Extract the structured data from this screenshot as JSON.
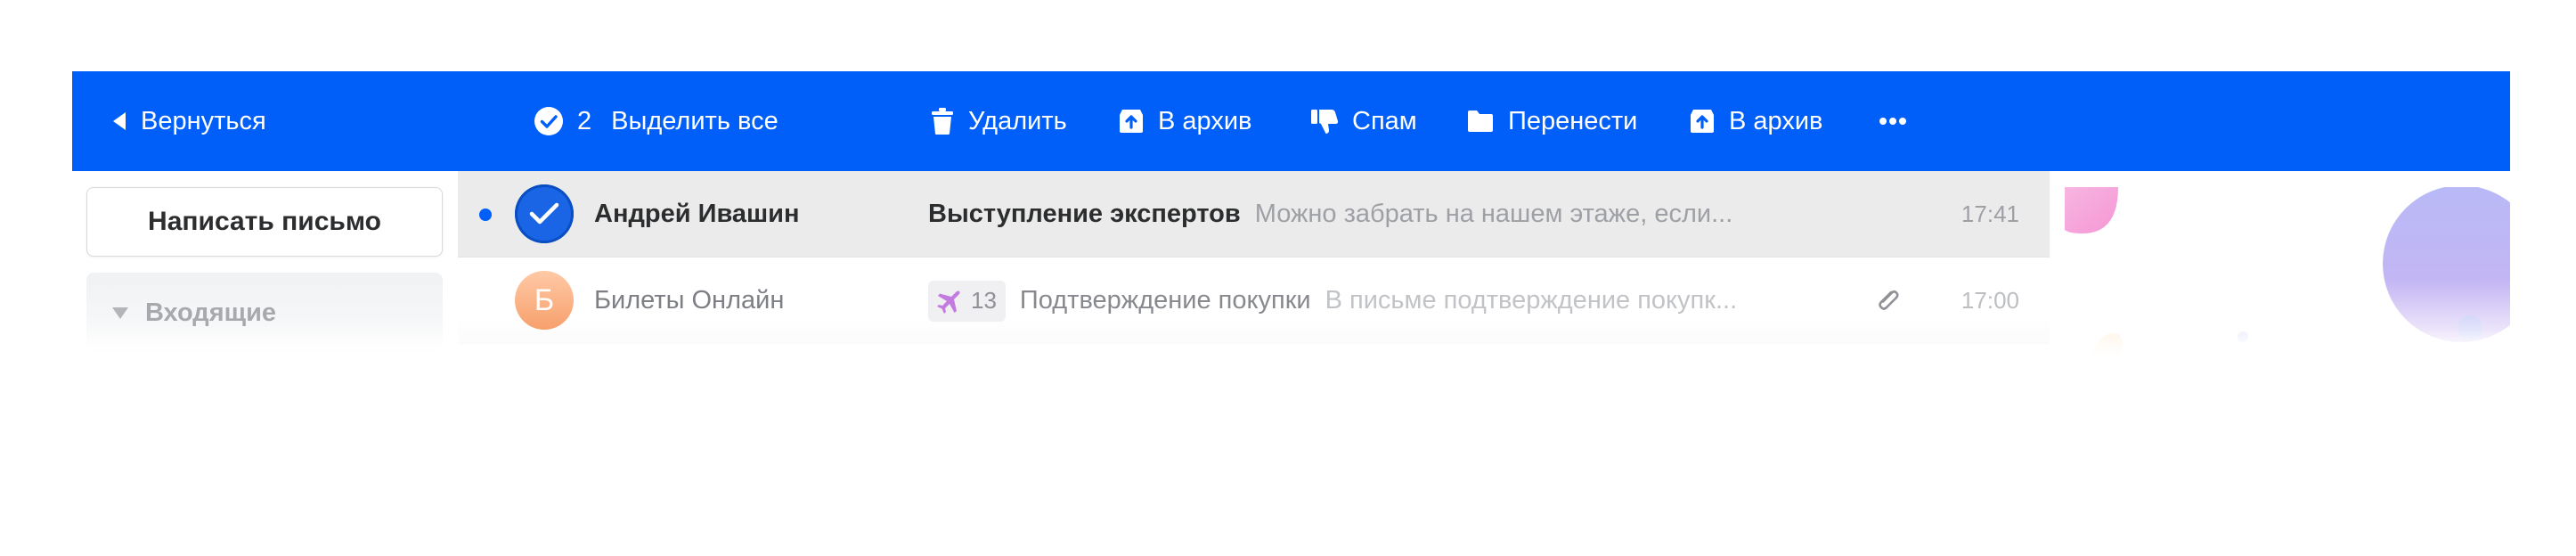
{
  "toolbar": {
    "back_label": "Вернуться",
    "selected_count": "2",
    "select_all_label": "Выделить все",
    "delete_label": "Удалить",
    "archive_label": "В архив",
    "spam_label": "Спам",
    "move_label": "Перенести",
    "archive2_label": "В архив",
    "more_icon": "more-dots-icon",
    "background": "#005ff9"
  },
  "sidebar": {
    "compose_label": "Написать письмо",
    "inbox_label": "Входящие"
  },
  "messages": [
    {
      "sender": "Андрей Ивашин",
      "subject": "Выступление экспертов",
      "snippet": "Можно забрать на нашем этаже, если...",
      "time": "17:41",
      "selected": true,
      "unread": true
    },
    {
      "avatar_letter": "Б",
      "sender": "Билеты Онлайн",
      "badge_count": "13",
      "badge_icon": "airplane-icon",
      "subject": "Подтверждение покупки",
      "snippet": "В письме подтверждение покупк...",
      "time": "17:00",
      "has_attachment": true
    }
  ],
  "colors": {
    "accent": "#005ff9",
    "selected_row": "#ebebeb",
    "avatar_orange": "#f7a06c"
  }
}
